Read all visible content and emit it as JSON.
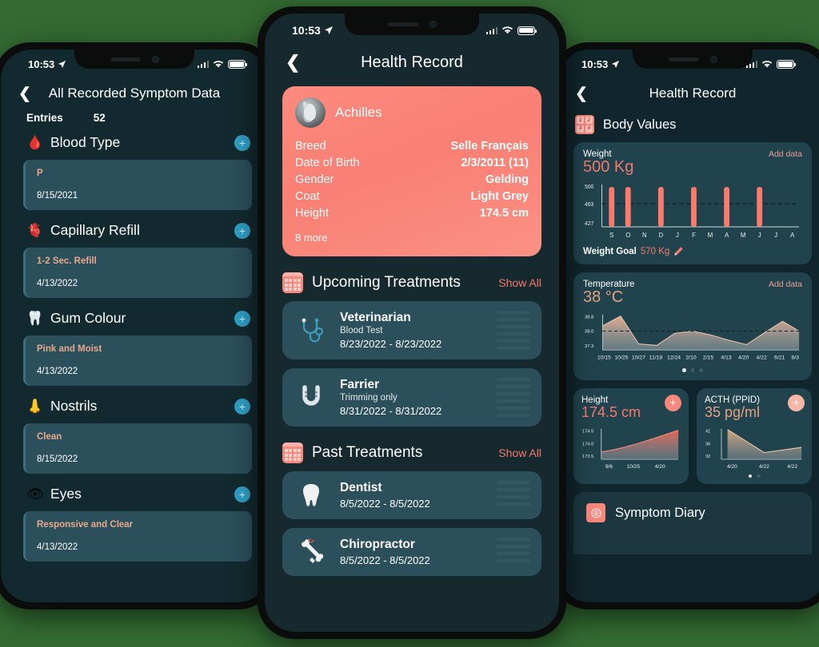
{
  "background_color": "#336b33",
  "accent_color": "#f4796c",
  "status_bar": {
    "time": "10:53",
    "location_icon": "location-arrow-icon"
  },
  "left_phone": {
    "nav": {
      "back_icon": "chevron-left-icon",
      "title": "All Recorded Symptom Data"
    },
    "entries_label": "Entries",
    "entries_count": "52",
    "add_icon": "plus-icon",
    "sections": [
      {
        "emoji": "🩸",
        "icon_name": "blood-drop-icon",
        "title": "Blood Type",
        "entry": {
          "value": "P",
          "date": "8/15/2021"
        }
      },
      {
        "emoji": "🫀",
        "icon_name": "capillary-icon",
        "title": "Capillary Refill",
        "entry": {
          "value": "1-2 Sec. Refill",
          "date": "4/13/2022"
        }
      },
      {
        "emoji": "🦷",
        "icon_name": "gum-tooth-icon",
        "title": "Gum Colour",
        "entry": {
          "value": "Pink and Moist",
          "date": "4/13/2022"
        }
      },
      {
        "emoji": "👃",
        "icon_name": "nostrils-icon",
        "title": "Nostrils",
        "entry": {
          "value": "Clean",
          "date": "8/15/2022"
        }
      },
      {
        "emoji": "👁",
        "icon_name": "eye-icon",
        "title": "Eyes",
        "entry": {
          "value": "Responsive and Clear",
          "date": "4/13/2022"
        }
      }
    ]
  },
  "center_phone": {
    "nav": {
      "back_icon": "chevron-left-icon",
      "title": "Health Record"
    },
    "pet": {
      "avatar_name": "horse-avatar",
      "name": "Achilles",
      "attributes": [
        {
          "key": "Breed",
          "value": "Selle Français"
        },
        {
          "key": "Date of Birth",
          "value": "2/3/2011 (11)"
        },
        {
          "key": "Gender",
          "value": "Gelding"
        },
        {
          "key": "Coat",
          "value": "Light Grey"
        },
        {
          "key": "Height",
          "value": "174.5 cm"
        }
      ],
      "more_label": "8 more"
    },
    "upcoming": {
      "icon_name": "calendar-icon",
      "title": "Upcoming Treatments",
      "show_all": "Show All",
      "items": [
        {
          "icon_name": "stethoscope-icon",
          "title": "Veterinarian",
          "subtitle": "Blood Test",
          "dates": "8/23/2022 - 8/23/2022"
        },
        {
          "icon_name": "horseshoe-icon",
          "title": "Farrier",
          "subtitle": "Trimming only",
          "dates": "8/31/2022 - 8/31/2022"
        }
      ]
    },
    "past": {
      "icon_name": "calendar-icon",
      "title": "Past Treatments",
      "show_all": "Show All",
      "items": [
        {
          "icon_name": "tooth-icon",
          "title": "Dentist",
          "subtitle": "",
          "dates": "8/5/2022 - 8/5/2022"
        },
        {
          "icon_name": "bone-icon",
          "title": "Chiropractor",
          "subtitle": "",
          "dates": "8/5/2022 - 8/5/2022"
        }
      ]
    }
  },
  "right_phone": {
    "nav": {
      "back_icon": "chevron-left-icon",
      "title": "Health Record"
    },
    "body_values": {
      "icon_name": "blocks-123-icon",
      "title": "Body Values"
    },
    "weight_card": {
      "label": "Weight",
      "add_label": "Add data",
      "value": "500 Kg",
      "goal_label": "Weight Goal",
      "goal_value": "570 Kg",
      "edit_icon": "pencil-icon"
    },
    "temperature_card": {
      "label": "Temperature",
      "add_label": "Add data",
      "value": "38 °C",
      "page_dots": {
        "count": 3,
        "active": 0
      }
    },
    "height_card": {
      "label": "Height",
      "value": "174.5 cm",
      "add_icon": "plus-icon"
    },
    "acth_card": {
      "label": "ACTH (PPID)",
      "value": "35 pg/ml",
      "add_icon": "plus-icon",
      "page_dots": {
        "count": 2,
        "active": 0
      }
    },
    "symptom_diary": {
      "icon_name": "diary-icon",
      "title": "Symptom Diary"
    }
  },
  "chart_data": [
    {
      "id": "weight",
      "type": "bar",
      "title": "Weight",
      "ylabel": "Kg",
      "categories": [
        "S",
        "O",
        "N",
        "D",
        "J",
        "F",
        "M",
        "A",
        "M",
        "J",
        "J",
        "A"
      ],
      "values": [
        500,
        500,
        null,
        500,
        null,
        500,
        null,
        500,
        null,
        500,
        null,
        null
      ],
      "ytick_labels": [
        "500",
        "463",
        "427"
      ],
      "ylim": [
        427,
        500
      ],
      "goal_line": 463,
      "grid": false,
      "legend": "none",
      "bar_color": "#fa7b6c"
    },
    {
      "id": "temperature",
      "type": "area",
      "title": "Temperature",
      "ylabel": "°C",
      "categories": [
        "10/15",
        "10/25",
        "10/27",
        "11/18",
        "12/24",
        "2/10",
        "2/15",
        "4/13",
        "4/20",
        "4/22",
        "6/21",
        "8/3"
      ],
      "values": [
        38.25,
        38.85,
        37.62,
        37.55,
        37.95,
        38.05,
        37.93,
        37.72,
        37.58,
        38.02,
        38.52,
        38.0
      ],
      "ytick_labels": [
        "38.8",
        "38.0",
        "37.3"
      ],
      "ylim": [
        37.3,
        38.8
      ],
      "reference_line": 38.0,
      "grid": false,
      "legend": "none",
      "area_color": "#e5a98d"
    },
    {
      "id": "height",
      "type": "area",
      "title": "Height",
      "ylabel": "cm",
      "categories": [
        "9/6",
        "10/25",
        "4/20"
      ],
      "values": [
        173.7,
        174.0,
        174.5
      ],
      "ytick_labels": [
        "174.5",
        "174.0",
        "173.5"
      ],
      "ylim": [
        173.5,
        174.5
      ],
      "grid": false,
      "legend": "none",
      "area_color": "#f06a5c"
    },
    {
      "id": "acth",
      "type": "area",
      "title": "ACTH (PPID)",
      "ylabel": "pg/ml",
      "categories": [
        "4/20",
        "4/22",
        "4/22"
      ],
      "values": [
        41,
        33,
        35
      ],
      "ytick_labels": [
        "41",
        "36",
        "32"
      ],
      "ylim": [
        32,
        41
      ],
      "grid": false,
      "legend": "none",
      "area_color": "#d9a483"
    }
  ]
}
